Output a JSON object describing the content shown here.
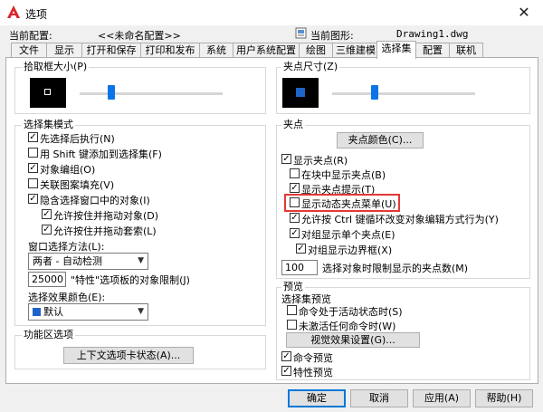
{
  "window": {
    "title": "选项",
    "close_glyph": "✕"
  },
  "profile": {
    "label": "当前配置:",
    "value": "<<未命名配置>>"
  },
  "drawing": {
    "label": "当前图形:",
    "value": "Drawing1.dwg"
  },
  "tabs": [
    {
      "label": "文件"
    },
    {
      "label": "显示"
    },
    {
      "label": "打开和保存"
    },
    {
      "label": "打印和发布"
    },
    {
      "label": "系统"
    },
    {
      "label": "用户系统配置"
    },
    {
      "label": "绘图"
    },
    {
      "label": "三维建模"
    },
    {
      "label": "选择集"
    },
    {
      "label": "配置"
    },
    {
      "label": "联机"
    }
  ],
  "left": {
    "pickbox": {
      "title": "拾取框大小(P)",
      "slider_value": 0.22
    },
    "select_modes": {
      "title": "选择集模式",
      "items": [
        {
          "label": "先选择后执行(N)",
          "checked": true
        },
        {
          "label": "用 Shift 键添加到选择集(F)",
          "checked": false
        },
        {
          "label": "对象编组(O)",
          "checked": true
        },
        {
          "label": "关联图案填充(V)",
          "checked": false
        },
        {
          "label": "隐含选择窗口中的对象(I)",
          "checked": true
        },
        {
          "label": "允许按住并拖动对象(D)",
          "checked": true
        },
        {
          "label": "允许按住并拖动套索(L)",
          "checked": true
        }
      ],
      "window_method_label": "窗口选择方法(L):",
      "window_method_value": "两者 - 自动检测",
      "limit_value": "25000",
      "limit_label": "\"特性\"选项板的对象限制(J)",
      "effect_color_label": "选择效果颜色(E):",
      "effect_color_value": "默认",
      "effect_color_hex": "#1e64c8"
    },
    "ribbon": {
      "title": "功能区选项",
      "button": "上下文选项卡状态(A)..."
    }
  },
  "right": {
    "gripsize": {
      "title": "夹点尺寸(Z)",
      "slider_value": 0.3
    },
    "grips": {
      "title": "夹点",
      "color_button": "夹点颜色(C)...",
      "items": [
        {
          "label": "显示夹点(R)",
          "checked": true
        },
        {
          "label": "在块中显示夹点(B)",
          "checked": false
        },
        {
          "label": "显示夹点提示(T)",
          "checked": true
        },
        {
          "label": "显示动态夹点菜单(U)",
          "checked": false
        },
        {
          "label": "允许按 Ctrl 键循环改变对象编辑方式行为(Y)",
          "checked": true
        },
        {
          "label": "对组显示单个夹点(E)",
          "checked": true
        },
        {
          "label": "对组显示边界框(X)",
          "checked": true
        }
      ],
      "limit_value": "100",
      "limit_label": "选择对象时限制显示的夹点数(M)"
    },
    "preview": {
      "title": "预览",
      "sub_title": "选择集预览",
      "items": [
        {
          "label": "命令处于活动状态时(S)",
          "checked": false
        },
        {
          "label": "未激活任何命令时(W)",
          "checked": false
        }
      ],
      "visual_button": "视觉效果设置(G)...",
      "items2": [
        {
          "label": "命令预览",
          "checked": true
        },
        {
          "label": "特性预览",
          "checked": true
        }
      ]
    }
  },
  "footer": {
    "ok": "确定",
    "cancel": "取消",
    "apply": "应用(A)",
    "help": "帮助(H)"
  },
  "colors": {
    "accent": "#0078d7",
    "slider": "#0a74e8",
    "grip": "#1e64c8",
    "highlight": "#e53935"
  }
}
